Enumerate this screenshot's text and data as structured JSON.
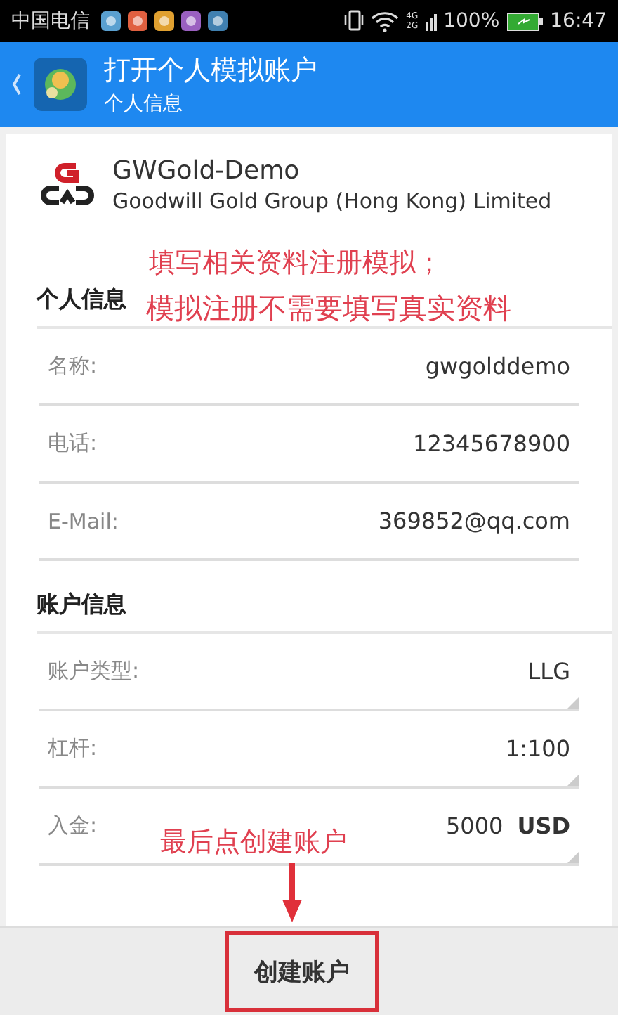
{
  "status_bar": {
    "carrier": "中国电信",
    "network_labels": [
      "4G",
      "2G"
    ],
    "battery": "100%",
    "time": "16:47"
  },
  "app_bar": {
    "title": "打开个人模拟账户",
    "subtitle": "个人信息"
  },
  "broker": {
    "name": "GWGold-Demo",
    "company": "Goodwill Gold Group (Hong Kong) Limited"
  },
  "sections": [
    {
      "title": "个人信息",
      "fields": [
        {
          "kind": "text",
          "label": "名称:",
          "value": "gwgolddemo"
        },
        {
          "kind": "text",
          "label": "电话:",
          "value": "12345678900"
        },
        {
          "kind": "text",
          "label": "E-Mail:",
          "value": "369852@qq.com"
        }
      ]
    },
    {
      "title": "账户信息",
      "fields": [
        {
          "kind": "select",
          "label": "账户类型:",
          "value": "LLG"
        },
        {
          "kind": "select",
          "label": "杠杆:",
          "value": "1:100"
        },
        {
          "kind": "select",
          "label": "入金:",
          "value": "5000",
          "unit": "USD"
        }
      ]
    }
  ],
  "annotations": [
    {
      "kind": "note",
      "lines": [
        "填写相关资料注册模拟；",
        "模拟注册不需要填写真实资料"
      ]
    },
    {
      "kind": "note_arrow",
      "lines": [
        "最后点创建账户"
      ]
    }
  ],
  "create_button": {
    "label": "创建账户",
    "highlighted": true
  }
}
